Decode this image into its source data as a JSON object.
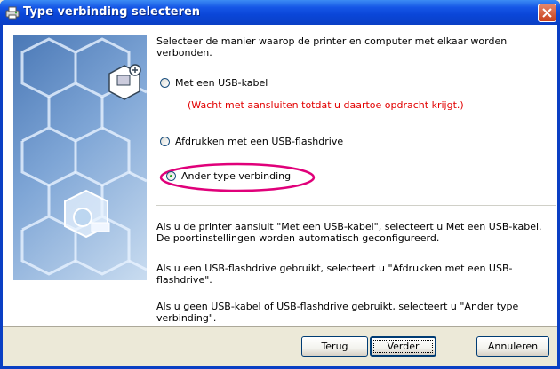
{
  "window": {
    "title": "Type verbinding selecteren"
  },
  "instruction": "Selecteer de manier waarop de printer en computer met elkaar worden verbonden.",
  "options": [
    {
      "label": "Met een USB-kabel",
      "selected": false
    },
    {
      "label": "Afdrukken met een USB-flashdrive",
      "selected": false
    },
    {
      "label": "Ander type verbinding",
      "selected": true
    }
  ],
  "warning": "(Wacht met aansluiten totdat u daartoe opdracht krijgt.)",
  "info": [
    "Als u de printer aansluit \"Met een USB-kabel\", selecteert u Met een USB-kabel. De poortinstellingen worden automatisch geconfigureerd.",
    "Als u een USB-flashdrive gebruikt, selecteert u \"Afdrukken met een USB-flashdrive\".",
    "Als u geen USB-kabel of USB-flashdrive gebruikt, selecteert u \"Ander type verbinding\"."
  ],
  "buttons": {
    "back": "Terug",
    "next": "Verder",
    "cancel": "Annuleren"
  },
  "colors": {
    "titlebar": "#0a46d8",
    "warning": "#e20000",
    "highlight": "#e0007a",
    "close": "#c8401c"
  },
  "icons": {
    "app": "printer-setup-icon",
    "close": "close-icon",
    "illustration": "hexagon-network-illustration",
    "connection": "connection-device-icon"
  }
}
